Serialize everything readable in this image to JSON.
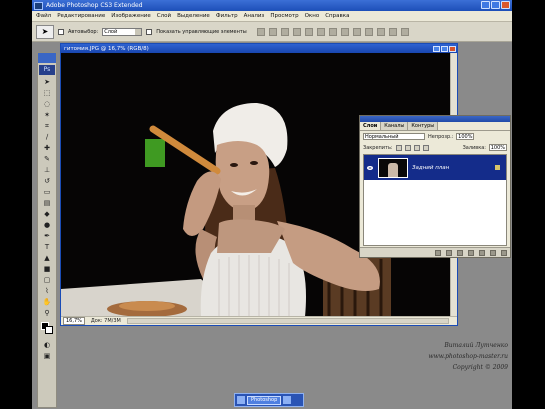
{
  "app": {
    "title": "Adobe Photoshop CS3 Extended"
  },
  "menu": [
    "Файл",
    "Редактирование",
    "Изображение",
    "Слой",
    "Выделение",
    "Фильтр",
    "Анализ",
    "Просмотр",
    "Окно",
    "Справка"
  ],
  "options": {
    "autoselect_label": "Автовыбор:",
    "autoselect_value": "Слой",
    "show_controls_label": "Показать управляющие элементы"
  },
  "document": {
    "title": "гитомия.JPG @ 16,7% (RGB/8)",
    "zoom": "16,7%",
    "doc_size": "Док: 7М/3М"
  },
  "layers_panel": {
    "tabs": [
      "Слои",
      "Каналы",
      "Контуры"
    ],
    "blend_mode": "Нормальный",
    "opacity_label": "Непрозр.:",
    "opacity_value": "100%",
    "lock_label": "Закрепить:",
    "fill_label": "Заливка:",
    "fill_value": "100%",
    "layer_name": "Задний план"
  },
  "watermark": {
    "line1": "Виталий Лутченко",
    "line2": "www.photoshop-master.ru",
    "line3": "Copyright © 2009"
  },
  "taskbar": {
    "item": "Photoshop"
  },
  "colors": {
    "titlebar": "#1d4fb8",
    "layer_selected": "#142c8a",
    "workspace": "#8a8a8a"
  }
}
